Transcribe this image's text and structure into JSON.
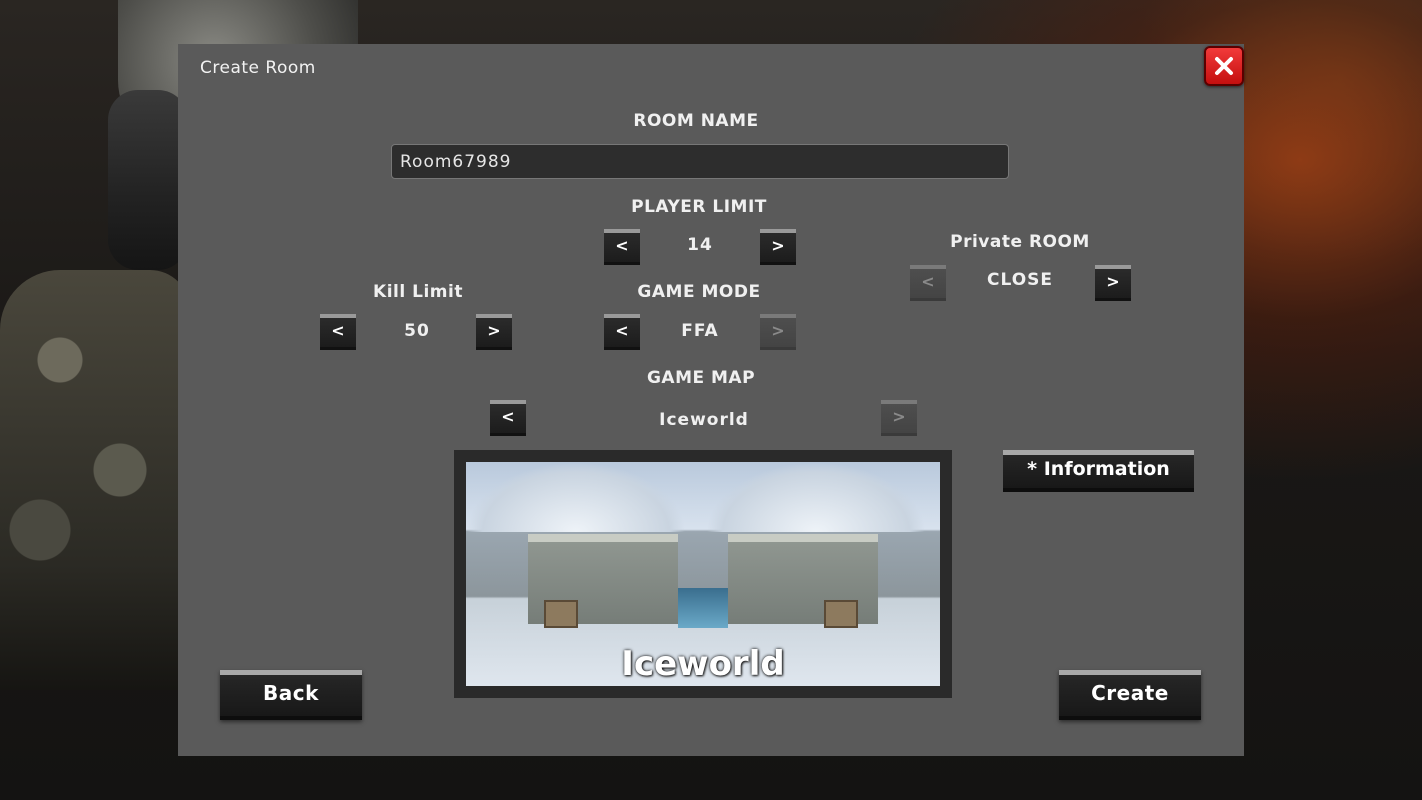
{
  "dialog": {
    "title": "Create Room"
  },
  "room_name": {
    "label": "ROOM NAME",
    "value": "Room67989"
  },
  "player_limit": {
    "label": "PLAYER LIMIT",
    "value": "14",
    "prev": "<",
    "next": ">"
  },
  "private_room": {
    "label": "Private ROOM",
    "value": "CLOSE",
    "prev": "<",
    "next": ">"
  },
  "kill_limit": {
    "label": "Kill Limit",
    "value": "50",
    "prev": "<",
    "next": ">"
  },
  "game_mode": {
    "label": "GAME MODE",
    "value": "FFA",
    "prev": "<",
    "next": ">"
  },
  "game_map": {
    "label": "GAME MAP",
    "value": "Iceworld",
    "prev": "<",
    "next": ">",
    "preview_caption": "Iceworld"
  },
  "buttons": {
    "information": "* Information",
    "back": "Back",
    "create": "Create"
  },
  "colors": {
    "close_button": "#d91818",
    "panel": "#5a5a5a"
  }
}
